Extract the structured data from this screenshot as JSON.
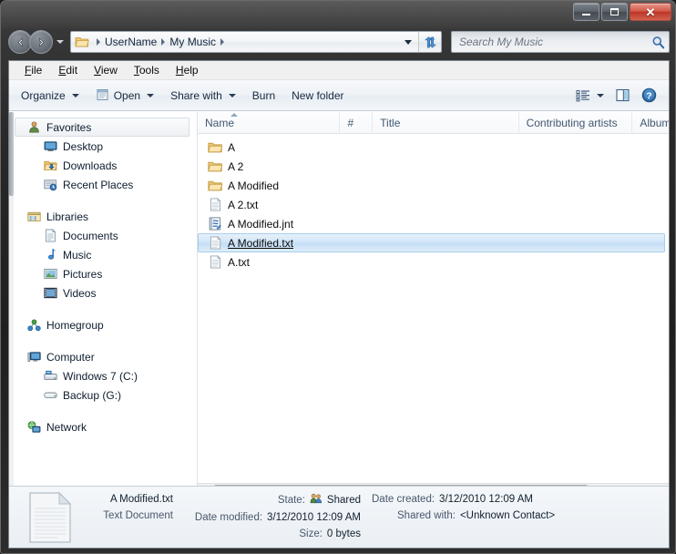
{
  "window": {
    "caption_buttons": {
      "minimize": "Minimize",
      "maximize": "Maximize",
      "close": "✕"
    }
  },
  "navigation": {
    "back_label": "Back",
    "forward_label": "Forward",
    "recent_pages_label": "Recent pages",
    "refresh_label": "Refresh"
  },
  "address": {
    "crumbs": [
      "UserName",
      "My Music"
    ],
    "dropdown_label": "Previous locations"
  },
  "search": {
    "placeholder": "Search My Music",
    "value": ""
  },
  "menubar": {
    "items": [
      {
        "accesskey": "F",
        "rest": "ile"
      },
      {
        "accesskey": "E",
        "rest": "dit"
      },
      {
        "accesskey": "V",
        "rest": "iew"
      },
      {
        "accesskey": "T",
        "rest": "ools"
      },
      {
        "accesskey": "H",
        "rest": "elp"
      }
    ]
  },
  "toolbar": {
    "organize": "Organize",
    "open": "Open",
    "share_with": "Share with",
    "burn": "Burn",
    "new_folder": "New folder",
    "views_label": "Change your view",
    "preview_label": "Show the preview pane",
    "help_label": "Get help"
  },
  "sidebar": {
    "groups": [
      {
        "header": {
          "label": "Favorites",
          "icon": "favorites-star-icon",
          "selected": true
        },
        "items": [
          {
            "label": "Desktop",
            "icon": "desktop-icon"
          },
          {
            "label": "Downloads",
            "icon": "downloads-icon"
          },
          {
            "label": "Recent Places",
            "icon": "recent-places-icon"
          }
        ]
      },
      {
        "header": {
          "label": "Libraries",
          "icon": "libraries-icon",
          "selected": false
        },
        "items": [
          {
            "label": "Documents",
            "icon": "documents-icon"
          },
          {
            "label": "Music",
            "icon": "music-note-icon"
          },
          {
            "label": "Pictures",
            "icon": "pictures-icon"
          },
          {
            "label": "Videos",
            "icon": "videos-icon"
          }
        ]
      },
      {
        "header": {
          "label": "Homegroup",
          "icon": "homegroup-icon",
          "selected": false
        },
        "items": []
      },
      {
        "header": {
          "label": "Computer",
          "icon": "computer-icon",
          "selected": false
        },
        "items": [
          {
            "label": "Windows 7 (C:)",
            "icon": "hard-drive-icon"
          },
          {
            "label": "Backup (G:)",
            "icon": "removable-drive-icon"
          }
        ]
      },
      {
        "header": {
          "label": "Network",
          "icon": "network-icon",
          "selected": false
        },
        "items": []
      }
    ]
  },
  "filelist": {
    "columns": [
      {
        "label": "Name",
        "sorted": "asc"
      },
      {
        "label": "#",
        "sorted": ""
      },
      {
        "label": "Title",
        "sorted": ""
      },
      {
        "label": "Contributing artists",
        "sorted": ""
      },
      {
        "label": "Album",
        "sorted": ""
      }
    ],
    "rows": [
      {
        "name": "A",
        "icon": "folder-icon",
        "selected": false
      },
      {
        "name": "A 2",
        "icon": "folder-icon",
        "selected": false
      },
      {
        "name": "A Modified",
        "icon": "folder-icon",
        "selected": false
      },
      {
        "name": "A 2.txt",
        "icon": "text-file-icon",
        "selected": false
      },
      {
        "name": "A Modified.jnt",
        "icon": "journal-note-icon",
        "selected": false
      },
      {
        "name": "A Modified.txt",
        "icon": "text-file-icon",
        "selected": true
      },
      {
        "name": "A.txt",
        "icon": "text-file-icon",
        "selected": false
      }
    ]
  },
  "details": {
    "filename": "A Modified.txt",
    "filetype": "Text Document",
    "state_label": "State:",
    "state_value": "Shared",
    "date_modified_label": "Date modified:",
    "date_modified_value": "3/12/2010 12:09 AM",
    "size_label": "Size:",
    "size_value": "0 bytes",
    "date_created_label": "Date created:",
    "date_created_value": "3/12/2010 12:09 AM",
    "shared_with_label": "Shared with:",
    "shared_with_value": "<Unknown Contact>"
  },
  "colors": {
    "selection_blue": "#c3dcf4",
    "selection_border": "#a8cdec",
    "close_red": "#bc3526",
    "folder_yellow": "#f5d99a",
    "header_text": "#3f5873"
  }
}
